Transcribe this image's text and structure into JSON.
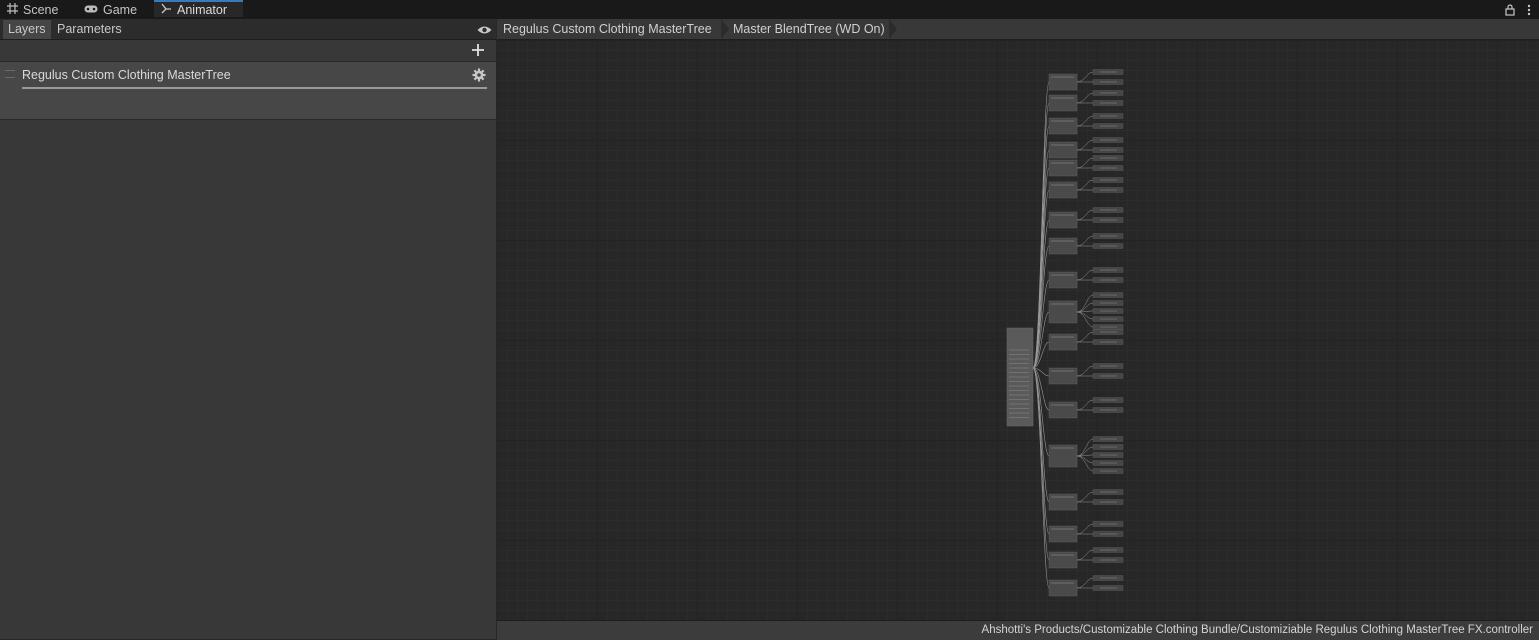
{
  "window_tabs": [
    {
      "label": "Scene",
      "icon": "grid-icon"
    },
    {
      "label": "Game",
      "icon": "gamepad-icon"
    },
    {
      "label": "Animator",
      "icon": "animator-icon",
      "active": true
    }
  ],
  "left_panel": {
    "tabs": [
      "Layers",
      "Parameters"
    ],
    "selected_tab": "Layers",
    "layers": [
      {
        "name": "Regulus Custom Clothing MasterTree",
        "weight": 1.0
      }
    ]
  },
  "breadcrumb": [
    "Regulus Custom Clothing MasterTree",
    "Master BlendTree (WD On)"
  ],
  "status": {
    "asset_path": "Ahshotti's Products/Customizable Clothing Bundle/Customiziable Regulus Clothing MasterTree FX.controller"
  },
  "colors": {
    "accent": "#3a79bb",
    "panel": "#383838",
    "graph_bg": "#272727"
  }
}
